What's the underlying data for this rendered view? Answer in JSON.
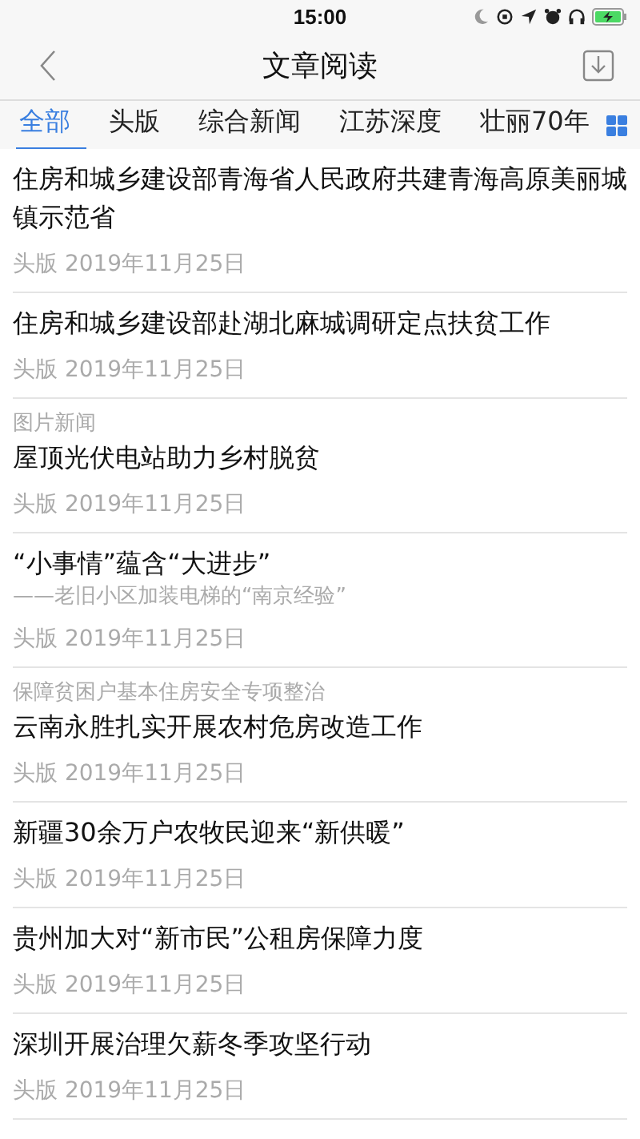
{
  "status_bar": {
    "time": "15:00"
  },
  "nav": {
    "title": "文章阅读"
  },
  "tabs": [
    {
      "label": "全部",
      "selected": true
    },
    {
      "label": "头版",
      "selected": false
    },
    {
      "label": "综合新闻",
      "selected": false
    },
    {
      "label": "江苏深度",
      "selected": false
    },
    {
      "label": "壮丽70年",
      "selected": false
    }
  ],
  "articles": [
    {
      "title": "住房和城乡建设部青海省人民政府共建青海高原美丽城镇示范省",
      "meta": "头版 2019年11月25日"
    },
    {
      "title": "住房和城乡建设部赴湖北麻城调研定点扶贫工作",
      "meta": "头版 2019年11月25日"
    },
    {
      "kicker": "图片新闻",
      "title": "屋顶光伏电站助力乡村脱贫",
      "meta": "头版 2019年11月25日"
    },
    {
      "title": "“小事情”蕴含“大进步”",
      "subtitle": "——老旧小区加装电梯的“南京经验”",
      "meta": "头版 2019年11月25日"
    },
    {
      "kicker": "保障贫困户基本住房安全专项整治",
      "title": "云南永胜扎实开展农村危房改造工作",
      "meta": "头版 2019年11月25日"
    },
    {
      "title": "新疆30余万户农牧民迎来“新供暖”",
      "meta": "头版 2019年11月25日"
    },
    {
      "title": "贵州加大对“新市民”公租房保障力度",
      "meta": "头版 2019年11月25日"
    },
    {
      "title": "深圳开展治理欠薪冬季攻坚行动",
      "meta": "头版 2019年11月25日"
    }
  ]
}
